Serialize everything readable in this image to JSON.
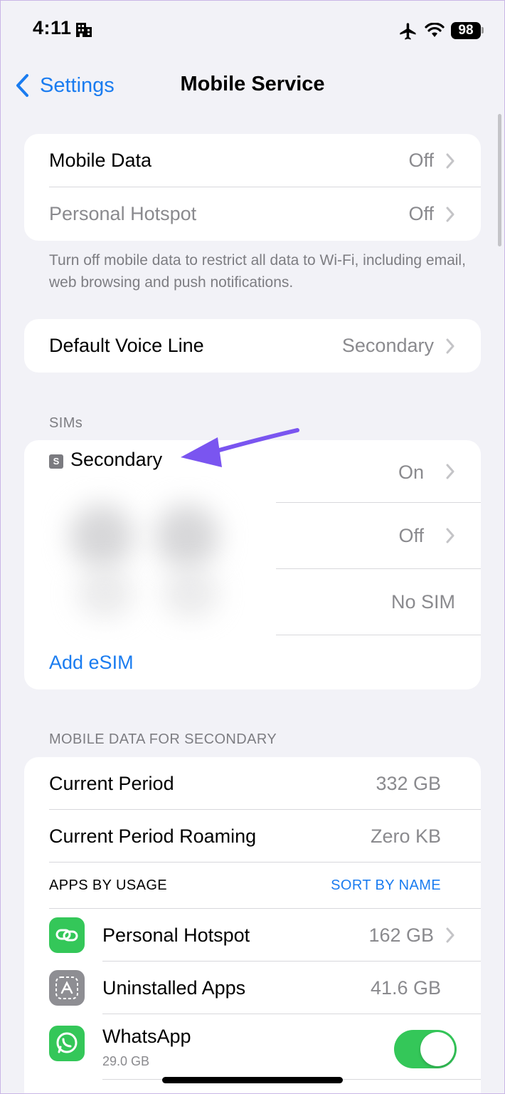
{
  "status_bar": {
    "time": "4:11",
    "battery": "98"
  },
  "nav": {
    "back_label": "Settings",
    "title": "Mobile Service"
  },
  "group_data": {
    "mobile_data_label": "Mobile Data",
    "mobile_data_value": "Off",
    "hotspot_label": "Personal Hotspot",
    "hotspot_value": "Off",
    "footer": "Turn off mobile data to restrict all data to Wi-Fi, including email, web browsing and push notifications."
  },
  "voice_line": {
    "label": "Default Voice Line",
    "value": "Secondary"
  },
  "sims": {
    "header": "SIMs",
    "badge": "S",
    "sim_name": "Secondary",
    "row1_value": "On",
    "row2_value": "Off",
    "row3_value": "No SIM",
    "add_esim": "Add eSIM"
  },
  "usage": {
    "header": "MOBILE DATA FOR SECONDARY",
    "current_period_label": "Current Period",
    "current_period_value": "332 GB",
    "roaming_label": "Current Period Roaming",
    "roaming_value": "Zero KB",
    "apps_header": "APPS BY USAGE",
    "sort_label": "SORT BY NAME",
    "apps": [
      {
        "name": "Personal Hotspot",
        "value": "162 GB",
        "icon": "link-icon",
        "color": "#34c759"
      },
      {
        "name": "Uninstalled Apps",
        "value": "41.6 GB",
        "icon": "app-store-icon",
        "color": "#8e8e93"
      },
      {
        "name": "WhatsApp",
        "subtitle": "29.0 GB",
        "icon": "whatsapp-icon",
        "color": "#34c759",
        "toggle_on": true
      }
    ]
  }
}
